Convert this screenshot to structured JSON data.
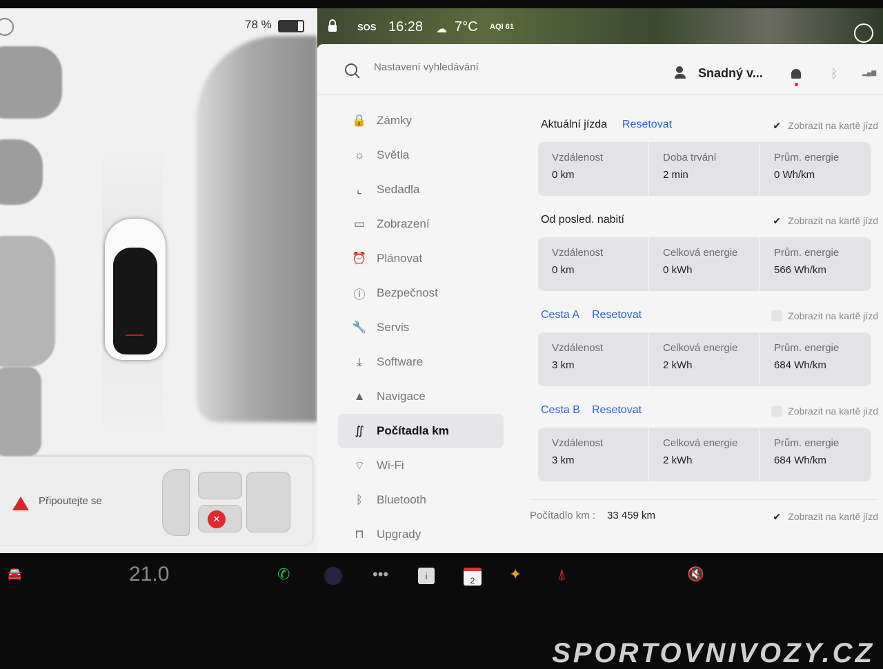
{
  "status": {
    "battery": "78 %",
    "sos": "SOS",
    "time": "16:28",
    "temperature": "7°C",
    "aqi": "AQI 61"
  },
  "alert": {
    "text": "Připoutejte se"
  },
  "search": {
    "placeholder": "Nastavení vyhledávání"
  },
  "profile": {
    "name": "Snadný v..."
  },
  "nav": {
    "items": [
      {
        "label": "Zámky",
        "icon": "lock-icon"
      },
      {
        "label": "Světla",
        "icon": "light-icon"
      },
      {
        "label": "Sedadla",
        "icon": "seat-icon"
      },
      {
        "label": "Zobrazení",
        "icon": "display-icon"
      },
      {
        "label": "Plánovat",
        "icon": "alarm-clock-icon"
      },
      {
        "label": "Bezpečnost",
        "icon": "info-circle-icon"
      },
      {
        "label": "Servis",
        "icon": "wrench-icon"
      },
      {
        "label": "Software",
        "icon": "download-icon"
      },
      {
        "label": "Navigace",
        "icon": "navigation-arrow-icon"
      },
      {
        "label": "Počítadla km",
        "icon": "trip-icon",
        "active": true
      },
      {
        "label": "Wi-Fi",
        "icon": "wifi-icon"
      },
      {
        "label": "Bluetooth",
        "icon": "bluetooth-icon"
      },
      {
        "label": "Upgrady",
        "icon": "shopping-bag-icon"
      }
    ]
  },
  "trips": {
    "show_on_card": "Zobrazit na kartě jízd",
    "reset": "Resetovat",
    "current": {
      "title": "Aktuální jízda",
      "checked": true,
      "stats": [
        {
          "label": "Vzdálenost",
          "value": "0 km"
        },
        {
          "label": "Doba trvání",
          "value": "2 min"
        },
        {
          "label": "Prům. energie",
          "value": "0 Wh/km"
        }
      ]
    },
    "since_charge": {
      "title": "Od posled. nabití",
      "checked": true,
      "stats": [
        {
          "label": "Vzdálenost",
          "value": "0 km"
        },
        {
          "label": "Celková energie",
          "value": "0 kWh"
        },
        {
          "label": "Prům. energie",
          "value": "566 Wh/km"
        }
      ]
    },
    "trip_a": {
      "title": "Cesta A",
      "checked": false,
      "stats": [
        {
          "label": "Vzdálenost",
          "value": "3 km"
        },
        {
          "label": "Celková energie",
          "value": "2 kWh"
        },
        {
          "label": "Prům. energie",
          "value": "684 Wh/km"
        }
      ]
    },
    "trip_b": {
      "title": "Cesta B",
      "checked": false,
      "stats": [
        {
          "label": "Vzdálenost",
          "value": "3 km"
        },
        {
          "label": "Celková energie",
          "value": "2 kWh"
        },
        {
          "label": "Prům. energie",
          "value": "684 Wh/km"
        }
      ]
    },
    "odometer": {
      "label": "Počítadlo km :",
      "value": "33 459 km",
      "checked": true
    }
  },
  "dock": {
    "cabin_temp": "21.0",
    "calendar_day": "2"
  },
  "watermark": "SPORTOVNIVOZY.CZ",
  "colors": {
    "accent_link": "#2e62d3",
    "alert_red": "#d9262b",
    "phone_green": "#2bbf4d"
  }
}
